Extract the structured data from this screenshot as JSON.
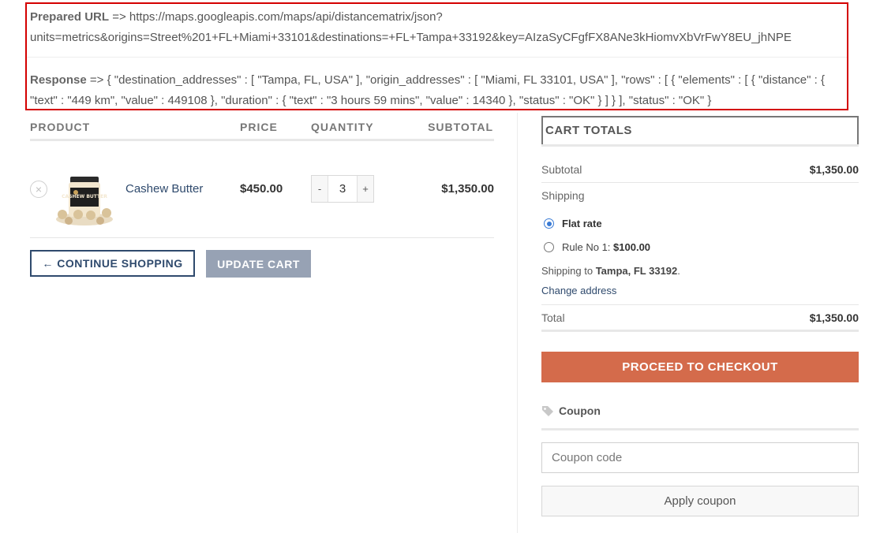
{
  "debug": {
    "url_label": "Prepared URL",
    "arrow": "=>",
    "url_line1": "https://maps.googleapis.com/maps/api/distancematrix/json?",
    "url_line2": "units=metrics&origins=Street%201+FL+Miami+33101&destinations=+FL+Tampa+33192&key=AIzaSyCFgfFX8ANe3kHiomvXbVrFwY8EU_jhNPE",
    "response_label": "Response",
    "response_line1": "{ \"destination_addresses\" : [ \"Tampa, FL, USA\" ], \"origin_addresses\" : [ \"Miami, FL 33101, USA\" ], \"rows\" : [ { \"elements\" : [ { \"distance\" : {",
    "response_line2": "\"text\" : \"449 km\", \"value\" : 449108 }, \"duration\" : { \"text\" : \"3 hours 59 mins\", \"value\" : 14340 }, \"status\" : \"OK\" } ] } ], \"status\" : \"OK\" }"
  },
  "cart": {
    "headers": {
      "product": "PRODUCT",
      "price": "PRICE",
      "quantity": "QUANTITY",
      "subtotal": "SUBTOTAL"
    },
    "items": [
      {
        "name": "Cashew Butter",
        "price": "$450.00",
        "quantity": "3",
        "subtotal": "$1,350.00",
        "thumb_text": "CASHEW BUTTER"
      }
    ],
    "remove_symbol": "×",
    "minus": "-",
    "plus": "+",
    "continue_label": "← CONTINUE SHOPPING",
    "update_label": "UPDATE CART"
  },
  "totals": {
    "title": "CART TOTALS",
    "subtotal_label": "Subtotal",
    "subtotal_value": "$1,350.00",
    "shipping_label": "Shipping",
    "options": [
      {
        "label": "Flat rate",
        "price": "",
        "selected": true
      },
      {
        "label": "Rule No 1:",
        "price": "$100.00",
        "selected": false
      }
    ],
    "shipping_to_prefix": "Shipping to",
    "shipping_to_place": "Tampa, FL 33192",
    "shipping_to_suffix": ".",
    "change_address": "Change address",
    "total_label": "Total",
    "total_value": "$1,350.00",
    "checkout_label": "PROCEED TO CHECKOUT"
  },
  "coupon": {
    "title": "Coupon",
    "icon": "tag-icon",
    "placeholder": "Coupon code",
    "apply_label": "Apply coupon"
  },
  "colors": {
    "debug_border": "#d40000",
    "navy": "#2f4a6d",
    "update_bg": "#97a2b4",
    "checkout_bg": "#d46b4b",
    "radio_selected": "#3a7bd5"
  }
}
